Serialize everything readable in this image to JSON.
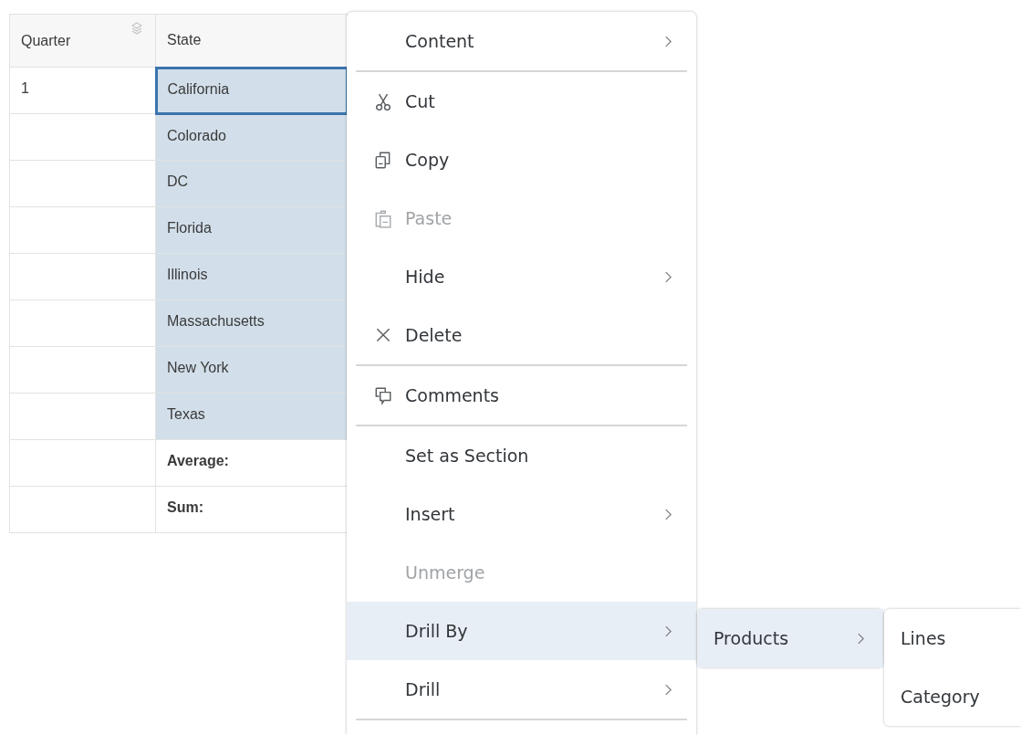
{
  "table": {
    "columns": [
      "Quarter",
      "State"
    ],
    "rows": [
      {
        "kind": "data",
        "quarter": "1",
        "state": "California",
        "selected": true,
        "focused": true
      },
      {
        "kind": "data",
        "state": "Colorado",
        "selected": true,
        "focused": false
      },
      {
        "kind": "data",
        "state": "DC",
        "selected": true,
        "focused": false
      },
      {
        "kind": "data",
        "state": "Florida",
        "selected": true,
        "focused": false
      },
      {
        "kind": "data",
        "state": "Illinois",
        "selected": true,
        "focused": false
      },
      {
        "kind": "data",
        "state": "Massachusetts",
        "selected": true,
        "focused": false
      },
      {
        "kind": "data",
        "state": "New York",
        "selected": true,
        "focused": false
      },
      {
        "kind": "data",
        "state": "Texas",
        "selected": true,
        "focused": false
      },
      {
        "kind": "total",
        "state": "Average:",
        "selected": false,
        "focused": false
      },
      {
        "kind": "total",
        "state": "Sum:",
        "selected": false,
        "focused": false
      }
    ]
  },
  "context_menu": [
    {
      "kind": "item",
      "label": "Content",
      "submenu": true,
      "disabled": false,
      "selected": false
    },
    {
      "kind": "separator"
    },
    {
      "kind": "cut",
      "label": "Cut",
      "submenu": false,
      "disabled": false,
      "selected": false
    },
    {
      "kind": "copy",
      "label": "Copy",
      "submenu": false,
      "disabled": false,
      "selected": false
    },
    {
      "kind": "paste",
      "label": "Paste",
      "submenu": false,
      "disabled": true,
      "selected": false
    },
    {
      "kind": "item",
      "label": "Hide",
      "submenu": true,
      "disabled": false,
      "selected": false
    },
    {
      "kind": "delete",
      "label": "Delete",
      "submenu": false,
      "disabled": false,
      "selected": false
    },
    {
      "kind": "separator"
    },
    {
      "kind": "comments",
      "label": "Comments",
      "submenu": false,
      "disabled": false,
      "selected": false
    },
    {
      "kind": "separator"
    },
    {
      "kind": "item",
      "label": "Set as Section",
      "submenu": false,
      "disabled": false,
      "selected": false
    },
    {
      "kind": "item",
      "label": "Insert",
      "submenu": true,
      "disabled": false,
      "selected": false
    },
    {
      "kind": "item",
      "label": "Unmerge",
      "submenu": false,
      "disabled": true,
      "selected": false
    },
    {
      "kind": "item",
      "label": "Drill By",
      "submenu": true,
      "disabled": false,
      "selected": true
    },
    {
      "kind": "item",
      "label": "Drill",
      "submenu": true,
      "disabled": false,
      "selected": false
    },
    {
      "kind": "separator"
    }
  ],
  "submenu": [
    {
      "label": "Products",
      "submenu": true,
      "selected": true
    }
  ],
  "sub_submenu": [
    {
      "label": "Lines",
      "selected": false
    },
    {
      "label": "Category",
      "selected": false
    }
  ]
}
